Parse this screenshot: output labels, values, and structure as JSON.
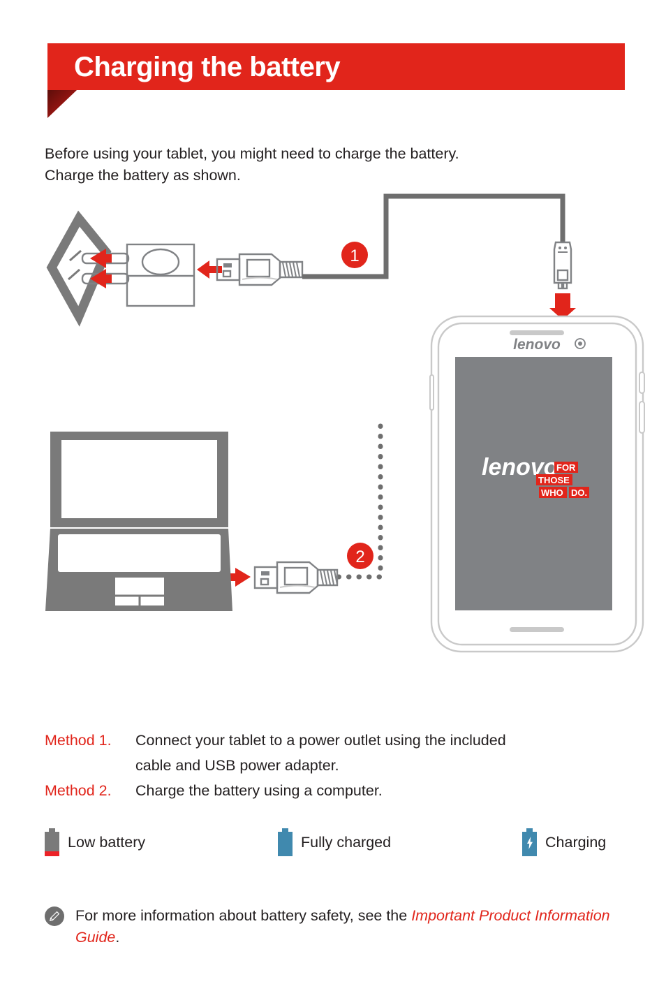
{
  "header": {
    "title": "Charging the battery",
    "banner_color": "#e1251b",
    "fold_color": "#5d0d0a"
  },
  "intro": {
    "line1": "Before using your tablet, you might need to charge the battery.",
    "line2": "Charge the battery as shown."
  },
  "diagram": {
    "step1_badge": "1",
    "step2_badge": "2",
    "badge_color": "#e1251b",
    "arrow_color": "#e1251b",
    "line_color": "#6e6e6e",
    "tablet": {
      "brand_logo": "lenovo",
      "screen_logo_word": "lenovo",
      "screen_logo_dot": ".",
      "screen_tagline_line1": "FOR",
      "screen_tagline_line2": "THOSE",
      "screen_tagline_line3a": "WHO",
      "screen_tagline_line3b": "DO.",
      "screen_color": "#808285",
      "tagline_box_color": "#e1251b",
      "camera_icon": "front-camera"
    },
    "elements": {
      "wall_outlet": "wall-outlet",
      "power_adapter": "usb-power-adapter",
      "usb_connector_1": "usb-a-connector",
      "usb_connector_2": "usb-a-connector",
      "micro_usb_connector": "micro-usb-connector",
      "laptop": "laptop-computer"
    }
  },
  "methods": [
    {
      "label": "Method 1.",
      "text": "Connect your tablet to a power outlet using the included",
      "continuation": "cable and USB power adapter."
    },
    {
      "label": "Method 2.",
      "text": "Charge the battery using a computer.",
      "continuation": ""
    }
  ],
  "legend": {
    "items": [
      {
        "label": "Low battery",
        "icon": "battery-low-icon",
        "color": "#7a7a7a",
        "accent": "#ec2227"
      },
      {
        "label": "Fully charged",
        "icon": "battery-full-icon",
        "color": "#4089ae",
        "accent": "#4089ae"
      },
      {
        "label": "Charging",
        "icon": "battery-charging-icon",
        "color": "#4089ae",
        "accent": "#ffffff"
      }
    ]
  },
  "note": {
    "icon": "pencil-note-icon",
    "text_before": "For more information about battery safety, see the ",
    "link_text": "Important Product Information Guide",
    "text_after": "."
  }
}
